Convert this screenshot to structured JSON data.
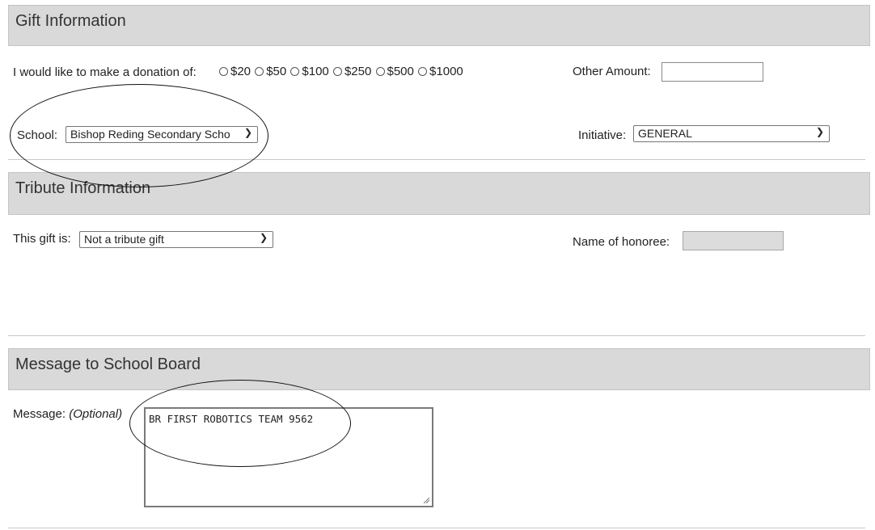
{
  "gift": {
    "header": "Gift Information",
    "donation_label": "I would like to make a donation of:",
    "amounts": [
      "$20",
      "$50",
      "$100",
      "$250",
      "$500",
      "$1000"
    ],
    "other_label": "Other Amount:",
    "other_value": "",
    "school_label": "School:",
    "school_value": "Bishop Reding Secondary Scho",
    "initiative_label": "Initiative:",
    "initiative_value": "GENERAL"
  },
  "tribute": {
    "header": "Tribute Information",
    "gift_is_label": "This gift is:",
    "gift_is_value": "Not a tribute gift",
    "honoree_label": "Name of honoree:",
    "honoree_value": ""
  },
  "message": {
    "header": "Message to School Board",
    "label": "Message:",
    "optional": "(Optional)",
    "value": "BR FIRST ROBOTICS TEAM 9562"
  }
}
